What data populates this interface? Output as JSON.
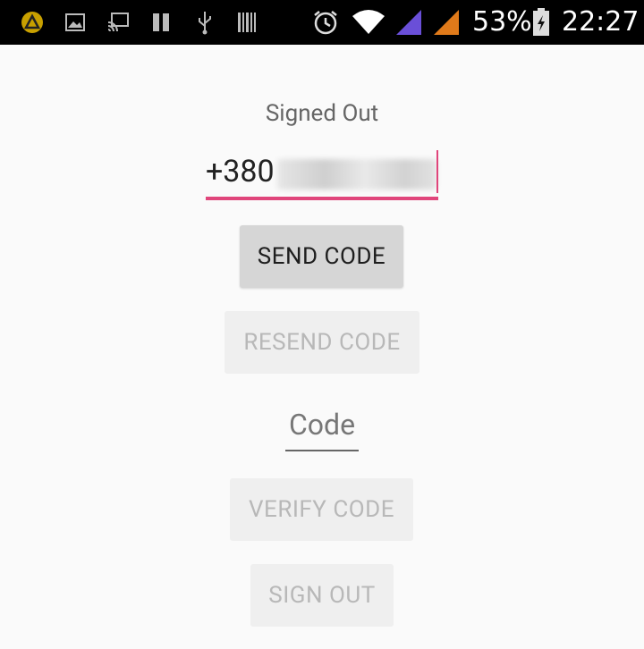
{
  "status_bar": {
    "battery": "53%",
    "time": "22:27",
    "icons": [
      "app-notification-icon",
      "image-icon",
      "cast-icon",
      "pause-icon",
      "usb-icon",
      "barcode-icon",
      "alarm-icon",
      "wifi-icon",
      "signal-sim1-icon",
      "signal-sim2-icon",
      "battery-icon"
    ],
    "colors": {
      "sim1_signal": "#6a4fd8",
      "sim2_signal": "#e07a1a",
      "notification_badge": "#c8a000"
    }
  },
  "main": {
    "status_label": "Signed Out",
    "phone_input": {
      "value": "+380",
      "accent": "#e0457b"
    },
    "send_code_label": "SEND CODE",
    "resend_code_label": "RESEND CODE",
    "code_input": {
      "placeholder": "Code"
    },
    "verify_code_label": "VERIFY CODE",
    "sign_out_label": "SIGN OUT"
  }
}
